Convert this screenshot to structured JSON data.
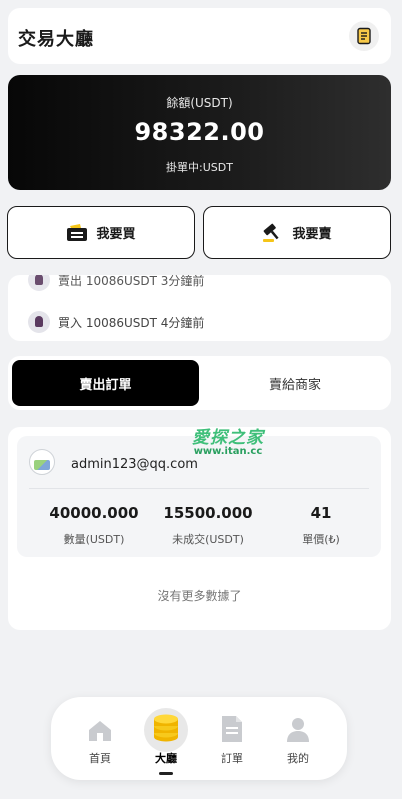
{
  "header": {
    "title": "交易大廳",
    "icon": "note-icon"
  },
  "balance": {
    "label": "餘額(USDT)",
    "amount": "98322.00",
    "pending": "掛單中:USDT"
  },
  "actions": {
    "buy_label": "我要買",
    "sell_label": "我要賣"
  },
  "ticker": {
    "prev_text": "賣出 10086USDT 3分鐘前",
    "current_text": "買入 10086USDT 4分鐘前"
  },
  "tabs": {
    "sell_orders": "賣出訂單",
    "sell_to_merchant": "賣給商家"
  },
  "order": {
    "email": "admin123@qq.com",
    "stats": [
      {
        "value": "40000.000",
        "label": "數量(USDT)"
      },
      {
        "value": "15500.000",
        "label": "未成交(USDT)"
      },
      {
        "value": "41",
        "label": "單價(₺)"
      }
    ],
    "empty_message": "沒有更多數據了"
  },
  "watermark": {
    "main": "愛探之家",
    "sub": "www.itan.cc"
  },
  "nav": {
    "items": [
      {
        "label": "首頁",
        "icon": "home-icon"
      },
      {
        "label": "大廳",
        "icon": "coins-icon",
        "active": true
      },
      {
        "label": "訂單",
        "icon": "document-icon"
      },
      {
        "label": "我的",
        "icon": "user-icon"
      }
    ]
  },
  "colors": {
    "accent": "#f5c518",
    "dark": "#0b0b0b",
    "background": "#f1f2f4"
  }
}
